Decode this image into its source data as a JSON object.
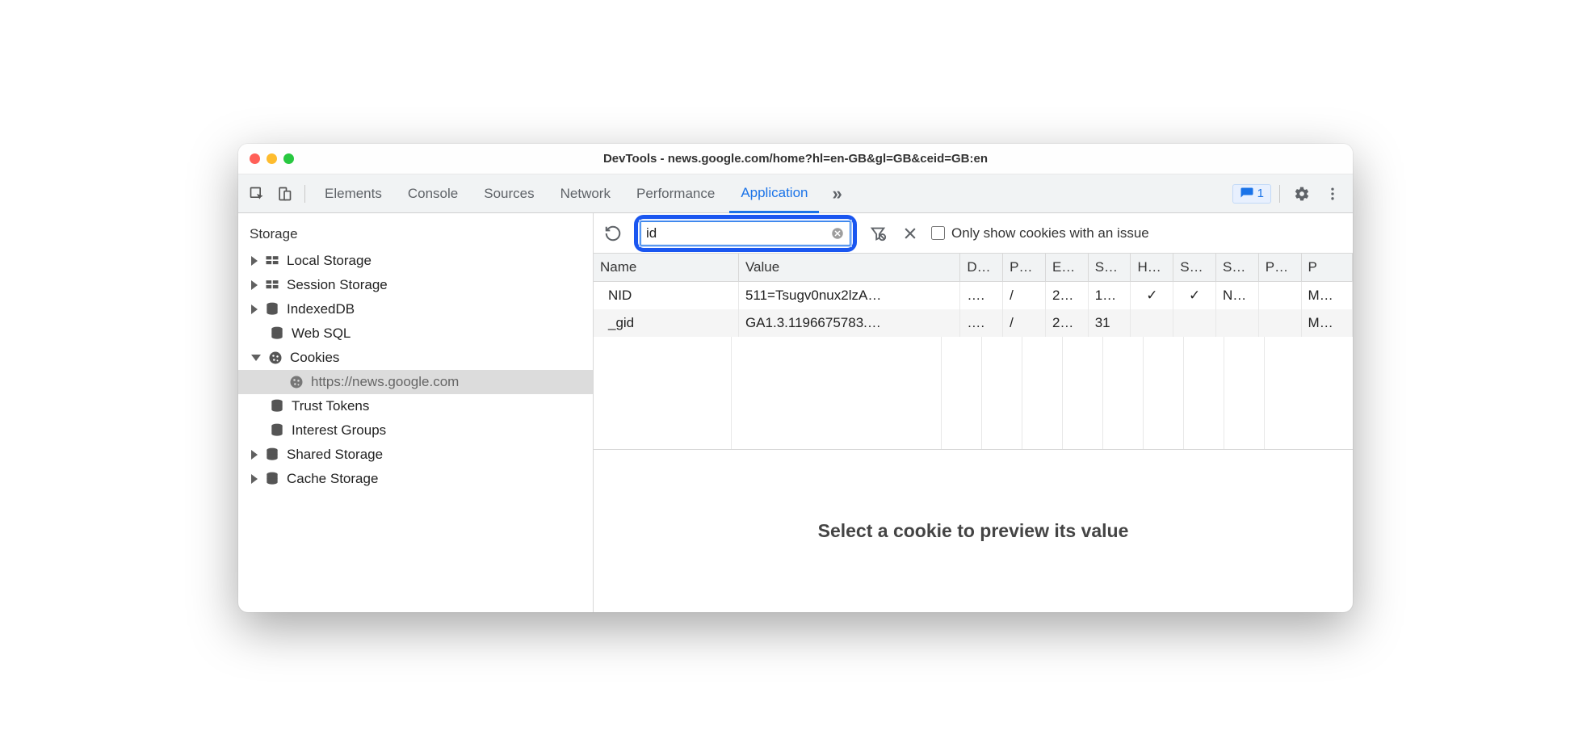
{
  "window": {
    "title": "DevTools - news.google.com/home?hl=en-GB&gl=GB&ceid=GB:en"
  },
  "tabs": {
    "elements": "Elements",
    "console": "Console",
    "sources": "Sources",
    "network": "Network",
    "performance": "Performance",
    "application": "Application",
    "more": "»",
    "issues_count": "1"
  },
  "sidebar": {
    "section": "Storage",
    "items": {
      "local_storage": "Local Storage",
      "session_storage": "Session Storage",
      "indexeddb": "IndexedDB",
      "websql": "Web SQL",
      "cookies": "Cookies",
      "cookies_origin": "https://news.google.com",
      "trust_tokens": "Trust Tokens",
      "interest_groups": "Interest Groups",
      "shared_storage": "Shared Storage",
      "cache_storage": "Cache Storage"
    }
  },
  "toolbar": {
    "filter_value": "id",
    "checkbox_label": "Only show cookies with an issue"
  },
  "table": {
    "headers": {
      "name": "Name",
      "value": "Value",
      "domain": "D…",
      "path": "P…",
      "expires": "E…",
      "size": "S…",
      "http": "H…",
      "secure": "S…",
      "samesite": "S…",
      "partition": "P…",
      "priority": "P"
    },
    "rows": [
      {
        "name": "NID",
        "value": "511=Tsugv0nux2lzA…",
        "domain": "….",
        "path": "/",
        "expires": "2…",
        "size": "1…",
        "http": "✓",
        "secure": "✓",
        "samesite": "N…",
        "partition": "",
        "priority": "M…"
      },
      {
        "name": "_gid",
        "value": "GA1.3.1196675783.…",
        "domain": "….",
        "path": "/",
        "expires": "2…",
        "size": "31",
        "http": "",
        "secure": "",
        "samesite": "",
        "partition": "",
        "priority": "M…"
      }
    ]
  },
  "preview": {
    "empty_text": "Select a cookie to preview its value"
  }
}
